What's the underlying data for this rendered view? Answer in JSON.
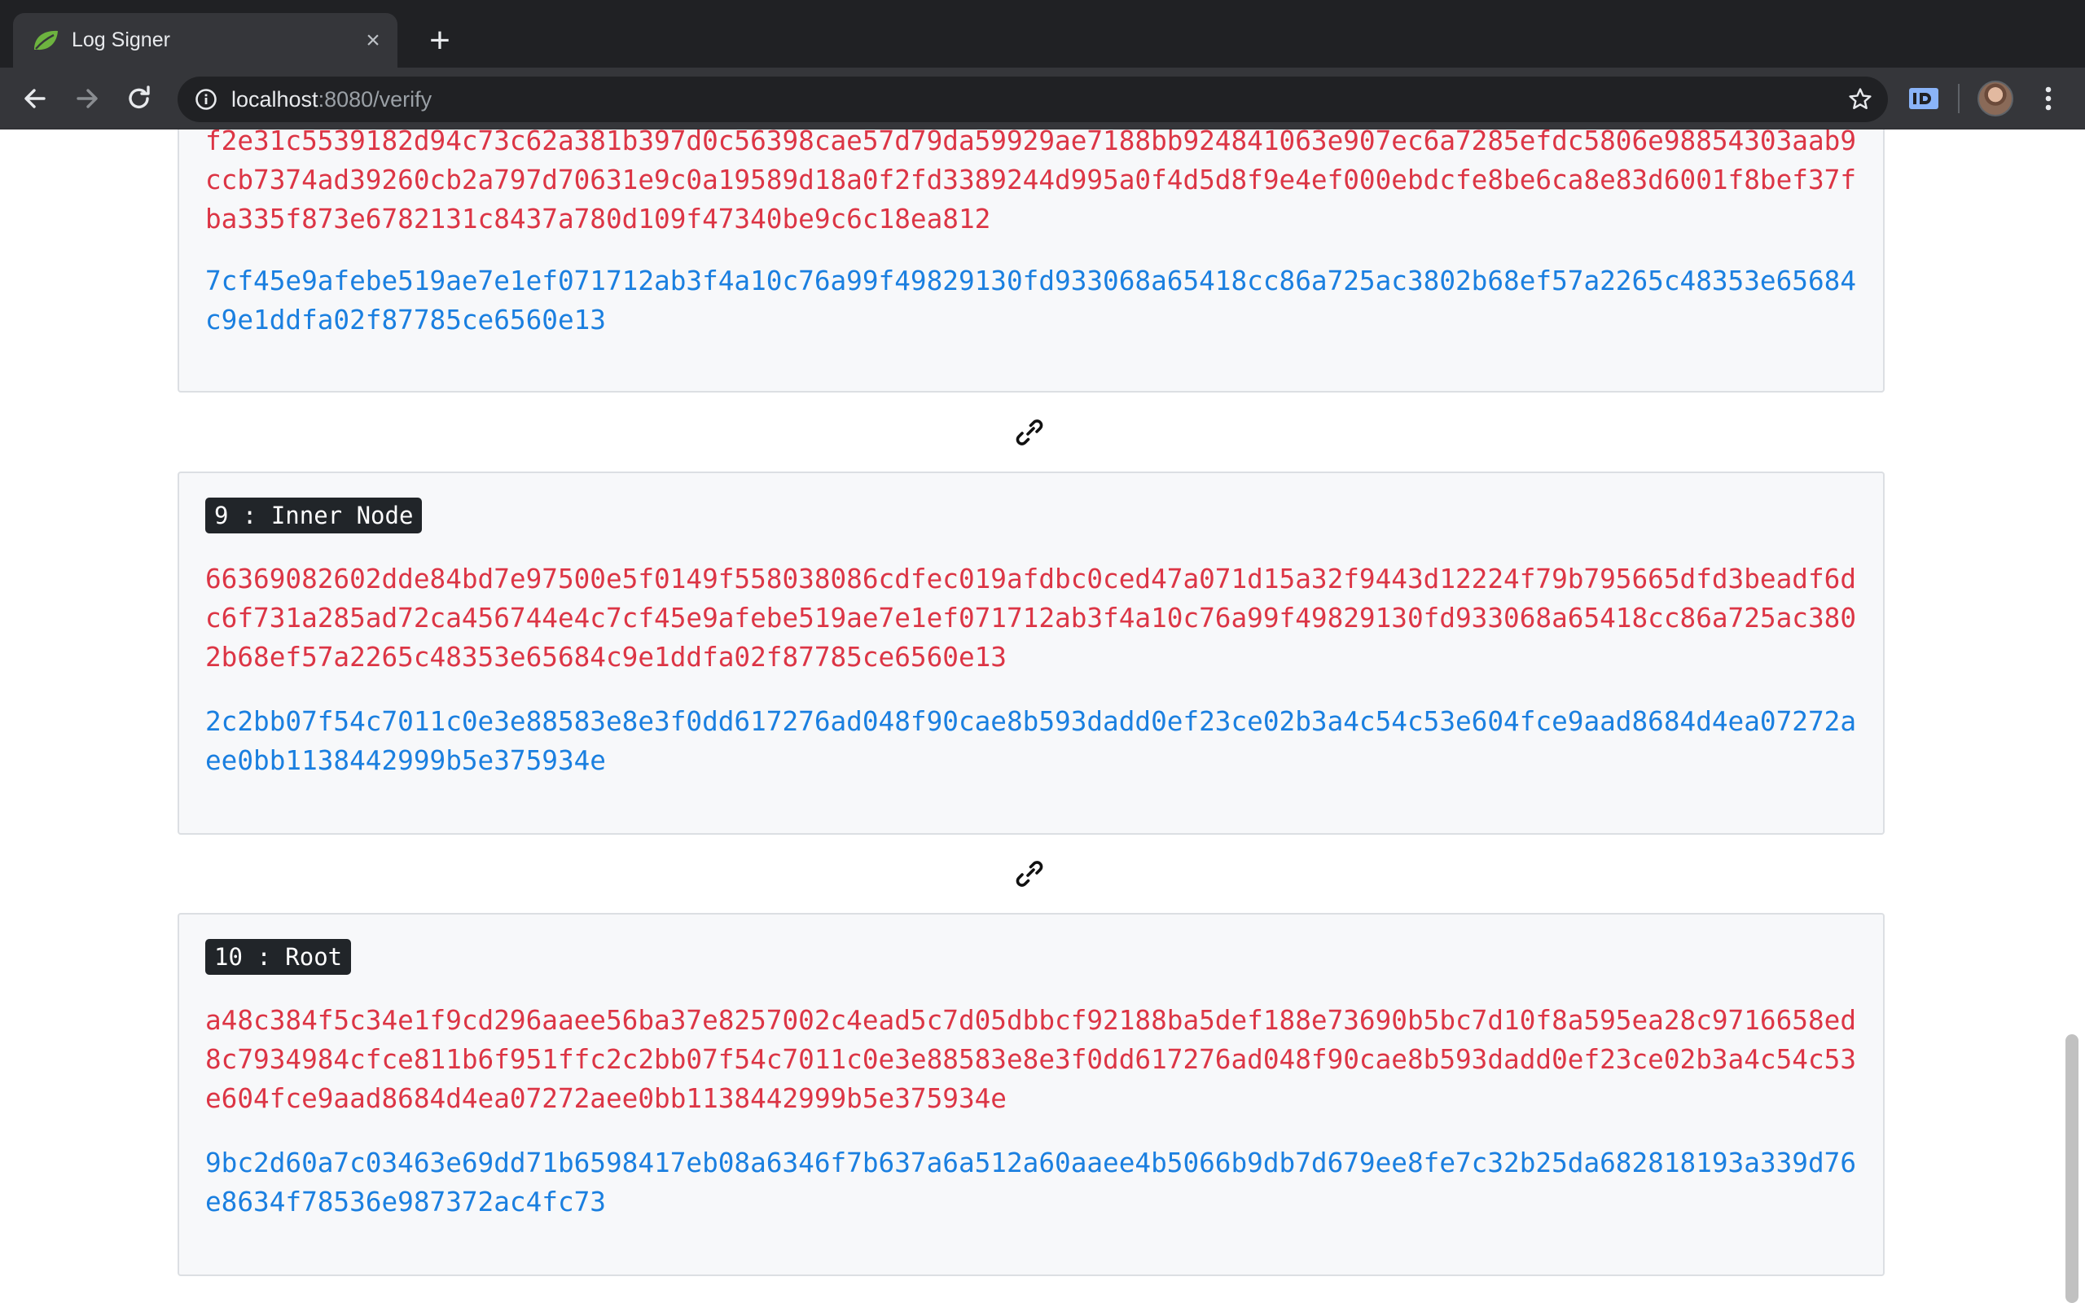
{
  "browser": {
    "tab_title": "Log Signer",
    "tab_close_glyph": "×",
    "new_tab_glyph": "+",
    "url_host": "localhost",
    "url_rest": ":8080/verify"
  },
  "icons": {
    "favicon": "spring-leaf-icon",
    "back": "arrow-left-icon",
    "forward": "arrow-right-icon",
    "reload": "reload-icon",
    "site_info": "info-icon",
    "bookmark": "star-icon",
    "extension": "id-extension-icon",
    "menu": "three-dots-icon",
    "connector": "link-icon"
  },
  "colors": {
    "hash_red": "#dc3545",
    "hash_blue": "#1a7fe0",
    "badge_bg": "#212529"
  },
  "nodes": [
    {
      "label": "",
      "hash_red": "f2e31c5539182d94c73c62a381b397d0c56398cae57d79da59929ae7188bb924841063e907ec6a7285efdc5806e98854303aab9ccb7374ad39260cb2a797d70631e9c0a19589d18a0f2fd3389244d995a0f4d5d8f9e4ef000ebdcfe8be6ca8e83d6001f8bef37fba335f873e6782131c8437a780d109f47340be9c6c18ea812",
      "hash_blue": "7cf45e9afebe519ae7e1ef071712ab3f4a10c76a99f49829130fd933068a65418cc86a725ac3802b68ef57a2265c48353e65684c9e1ddfa02f87785ce6560e13"
    },
    {
      "label": "9 : Inner Node",
      "hash_red": "66369082602dde84bd7e97500e5f0149f558038086cdfec019afdbc0ced47a071d15a32f9443d12224f79b795665dfd3beadf6dc6f731a285ad72ca456744e4c7cf45e9afebe519ae7e1ef071712ab3f4a10c76a99f49829130fd933068a65418cc86a725ac3802b68ef57a2265c48353e65684c9e1ddfa02f87785ce6560e13",
      "hash_blue": "2c2bb07f54c7011c0e3e88583e8e3f0dd617276ad048f90cae8b593dadd0ef23ce02b3a4c54c53e604fce9aad8684d4ea07272aee0bb1138442999b5e375934e"
    },
    {
      "label": "10 : Root",
      "hash_red": "a48c384f5c34e1f9cd296aaee56ba37e8257002c4ead5c7d05dbbcf92188ba5def188e73690b5bc7d10f8a595ea28c9716658ed8c7934984cfce811b6f951ffc2c2bb07f54c7011c0e3e88583e8e3f0dd617276ad048f90cae8b593dadd0ef23ce02b3a4c54c53e604fce9aad8684d4ea07272aee0bb1138442999b5e375934e",
      "hash_blue": "9bc2d60a7c03463e69dd71b6598417eb08a6346f7b637a6a512a60aaee4b5066b9db7d679ee8fe7c32b25da682818193a339d76e8634f78536e987372ac4fc73"
    }
  ]
}
